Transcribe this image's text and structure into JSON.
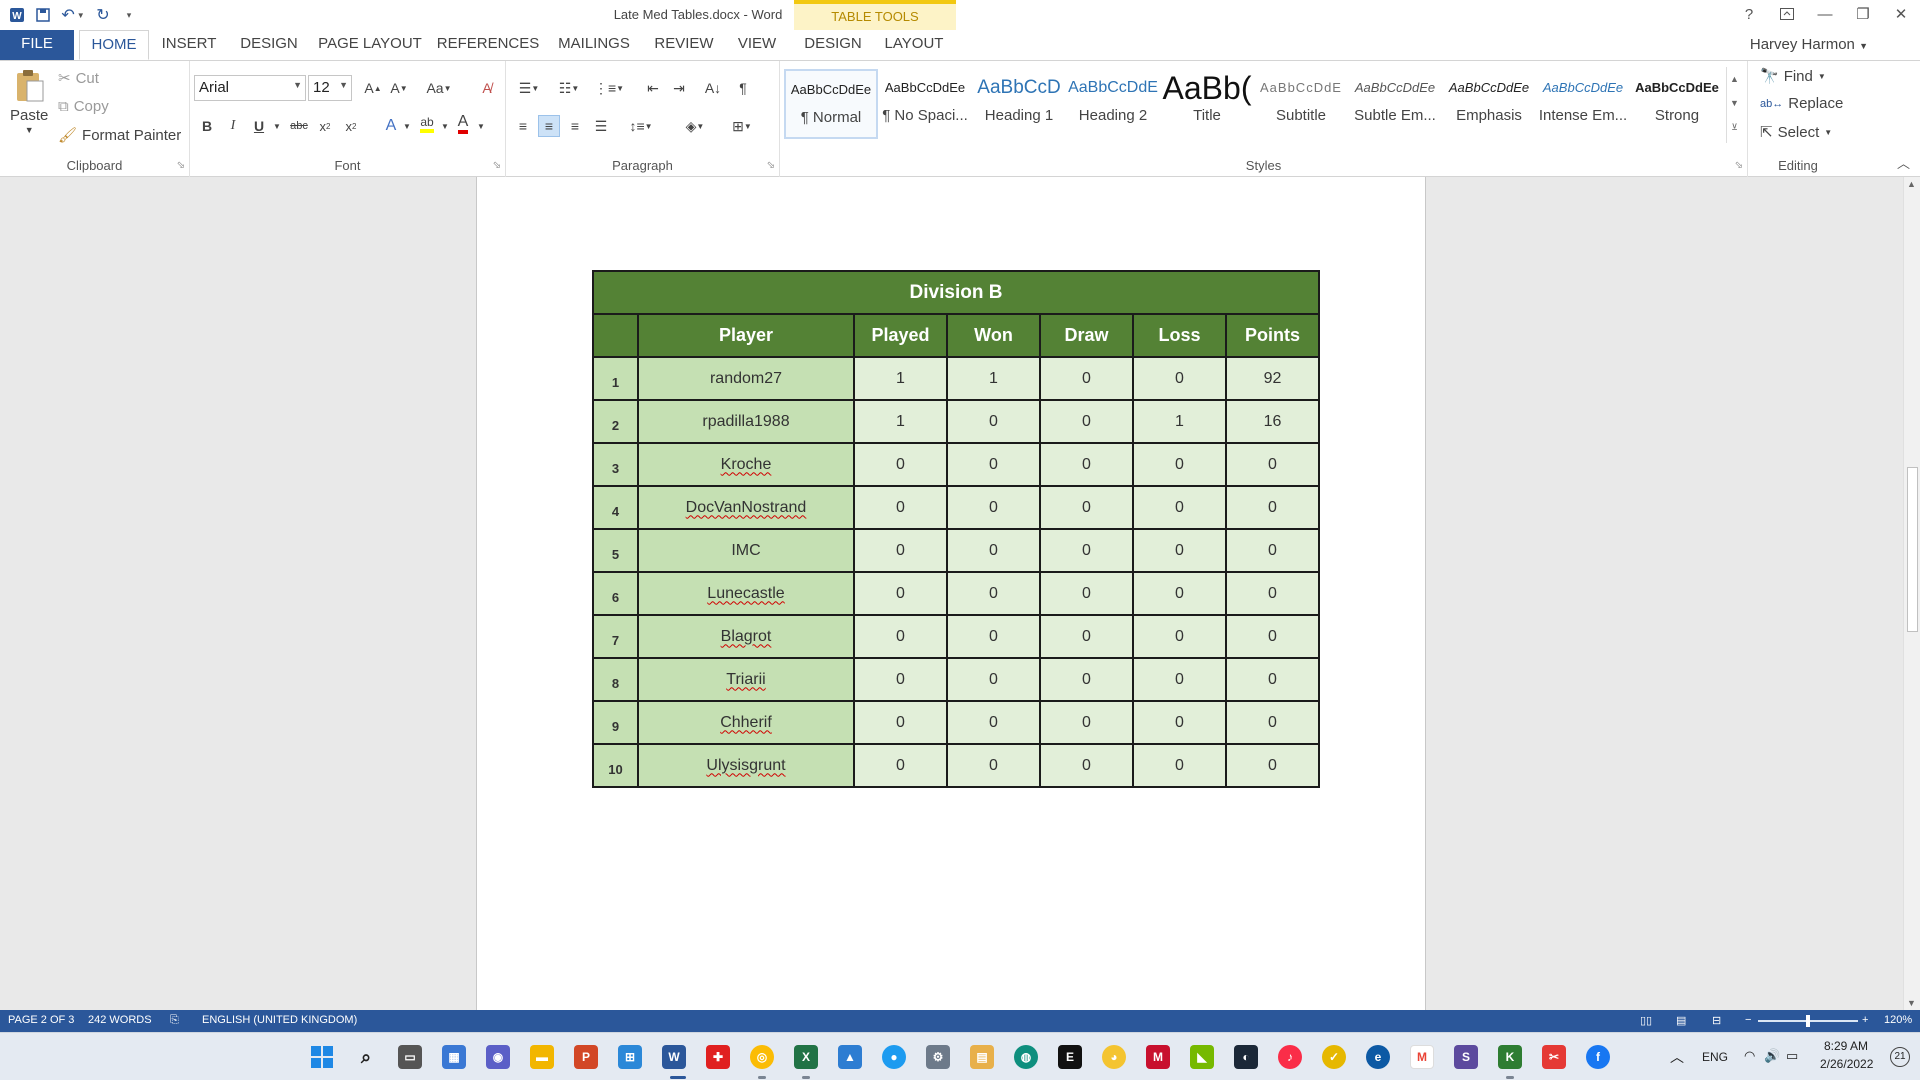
{
  "titlebar": {
    "title": "Late Med Tables.docx - Word",
    "table_tools": "TABLE TOOLS",
    "qat_icons": [
      "word-icon",
      "save-icon",
      "undo-icon",
      "redo-icon",
      "customize-icon"
    ],
    "help": "?"
  },
  "tabs": {
    "file": "FILE",
    "items": [
      "HOME",
      "INSERT",
      "DESIGN",
      "PAGE LAYOUT",
      "REFERENCES",
      "MAILINGS",
      "REVIEW",
      "VIEW"
    ],
    "tool_items": [
      "DESIGN",
      "LAYOUT"
    ],
    "active": "HOME",
    "user": "Harvey Harmon"
  },
  "ribbon": {
    "clipboard": {
      "label": "Clipboard",
      "paste": "Paste",
      "cut": "Cut",
      "copy": "Copy",
      "format_painter": "Format Painter"
    },
    "font": {
      "label": "Font",
      "family": "Arial",
      "size": "12"
    },
    "paragraph": {
      "label": "Paragraph"
    },
    "styles": {
      "label": "Styles",
      "items": [
        {
          "preview": "AaBbCcDdEe",
          "name": "¶ Normal"
        },
        {
          "preview": "AaBbCcDdEe",
          "name": "¶ No Spaci..."
        },
        {
          "preview": "AaBbCcD",
          "name": "Heading 1"
        },
        {
          "preview": "AaBbCcDdE",
          "name": "Heading 2"
        },
        {
          "preview": "AaBb(",
          "name": "Title"
        },
        {
          "preview": "AaBbCcDdE",
          "name": "Subtitle"
        },
        {
          "preview": "AaBbCcDdEe",
          "name": "Subtle Em..."
        },
        {
          "preview": "AaBbCcDdEe",
          "name": "Emphasis"
        },
        {
          "preview": "AaBbCcDdEe",
          "name": "Intense Em..."
        },
        {
          "preview": "AaBbCcDdEe",
          "name": "Strong"
        }
      ]
    },
    "editing": {
      "label": "Editing",
      "find": "Find",
      "replace": "Replace",
      "select": "Select"
    }
  },
  "table": {
    "title": "Division B",
    "headers": [
      "Player",
      "Played",
      "Won",
      "Draw",
      "Loss",
      "Points"
    ],
    "rows": [
      {
        "n": "1",
        "player": "random27",
        "played": "1",
        "won": "1",
        "draw": "0",
        "loss": "0",
        "points": "92"
      },
      {
        "n": "2",
        "player": "rpadilla1988",
        "played": "1",
        "won": "0",
        "draw": "0",
        "loss": "1",
        "points": "16"
      },
      {
        "n": "3",
        "player": "Kroche",
        "played": "0",
        "won": "0",
        "draw": "0",
        "loss": "0",
        "points": "0"
      },
      {
        "n": "4",
        "player": "DocVanNostrand",
        "played": "0",
        "won": "0",
        "draw": "0",
        "loss": "0",
        "points": "0"
      },
      {
        "n": "5",
        "player": "IMC",
        "played": "0",
        "won": "0",
        "draw": "0",
        "loss": "0",
        "points": "0"
      },
      {
        "n": "6",
        "player": "Lunecastle",
        "played": "0",
        "won": "0",
        "draw": "0",
        "loss": "0",
        "points": "0"
      },
      {
        "n": "7",
        "player": "Blagrot",
        "played": "0",
        "won": "0",
        "draw": "0",
        "loss": "0",
        "points": "0"
      },
      {
        "n": "8",
        "player": "Triarii",
        "played": "0",
        "won": "0",
        "draw": "0",
        "loss": "0",
        "points": "0"
      },
      {
        "n": "9",
        "player": "Chherif",
        "played": "0",
        "won": "0",
        "draw": "0",
        "loss": "0",
        "points": "0"
      },
      {
        "n": "10",
        "player": "Ulysisgrunt",
        "played": "0",
        "won": "0",
        "draw": "0",
        "loss": "0",
        "points": "0"
      }
    ]
  },
  "statusbar": {
    "page": "PAGE 2 OF 3",
    "words": "242 WORDS",
    "language": "ENGLISH (UNITED KINGDOM)",
    "zoom": "120%"
  },
  "taskbar": {
    "lang": "ENG",
    "time": "8:29 AM",
    "date": "2/26/2022",
    "notifications": "21"
  },
  "colors": {
    "word_blue": "#2b579a",
    "table_header": "#548235",
    "table_dark_cell": "#c5e0b3",
    "table_light_cell": "#e2efd9",
    "table_tools_yellow": "#f2c811"
  }
}
